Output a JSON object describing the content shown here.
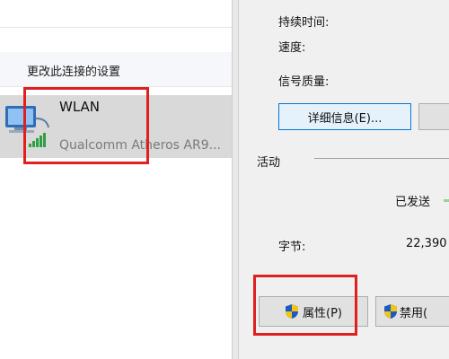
{
  "left": {
    "command": "更改此连接的设置",
    "connection": {
      "name": "WLAN",
      "adapter": "Qualcomm Atheros AR9..."
    }
  },
  "dialog": {
    "duration_label": "持续时间:",
    "speed_label": "速度:",
    "signal_label": "信号质量:",
    "details_button": "详细信息(E)...",
    "activity_label": "活动",
    "sent_label": "已发送",
    "bytes_label": "字节:",
    "bytes_sent": "22,390",
    "properties_button": "属性(P)",
    "disable_button": "禁用("
  },
  "colors": {
    "highlight": "#e02020",
    "selected_row": "#d9d9d9",
    "focus_border": "#0078d7"
  },
  "icons": {
    "network_adapter": "network-adapter-icon",
    "signal": "wifi-signal-icon",
    "shield": "uac-shield-icon"
  }
}
